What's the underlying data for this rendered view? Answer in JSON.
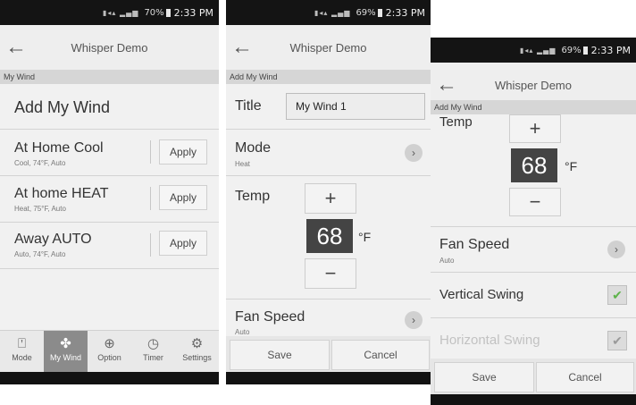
{
  "phone1": {
    "status": {
      "time": "2:33 PM",
      "battery": "70%"
    },
    "appbar": {
      "title": "Whisper Demo"
    },
    "section": "My Wind",
    "header": "Add My Wind",
    "items": [
      {
        "title": "At Home Cool",
        "subtitle": "Cool, 74°F, Auto",
        "action": "Apply"
      },
      {
        "title": "At home HEAT",
        "subtitle": "Heat, 75°F, Auto",
        "action": "Apply"
      },
      {
        "title": "Away AUTO",
        "subtitle": "Auto, 74°F, Auto",
        "action": "Apply"
      }
    ],
    "nav": [
      {
        "label": "Mode",
        "icon": "mode-icon"
      },
      {
        "label": "My Wind",
        "icon": "fan-icon"
      },
      {
        "label": "Option",
        "icon": "plus-circle-icon"
      },
      {
        "label": "Timer",
        "icon": "clock-icon"
      },
      {
        "label": "Settings",
        "icon": "gear-icon"
      }
    ]
  },
  "phone2": {
    "status": {
      "time": "2:33 PM",
      "battery": "69%"
    },
    "appbar": {
      "title": "Whisper Demo"
    },
    "section": "Add My Wind",
    "title_label": "Title",
    "title_value": "My Wind 1",
    "mode_label": "Mode",
    "mode_value": "Heat",
    "temp_label": "Temp",
    "temp_plus": "+",
    "temp_value": "68",
    "temp_unit": "°F",
    "temp_minus": "−",
    "fan_label": "Fan Speed",
    "fan_value": "Auto",
    "save": "Save",
    "cancel": "Cancel"
  },
  "phone3": {
    "status": {
      "time": "2:33 PM",
      "battery": "69%"
    },
    "appbar": {
      "title": "Whisper Demo"
    },
    "section": "Add My Wind",
    "temp_label": "Temp",
    "temp_plus": "+",
    "temp_value": "68",
    "temp_unit": "°F",
    "temp_minus": "−",
    "fan_label": "Fan Speed",
    "fan_value": "Auto",
    "vswing_label": "Vertical Swing",
    "hswing_label": "Horizontal Swing",
    "save": "Save",
    "cancel": "Cancel",
    "colors": {
      "check_green": "#5db34a",
      "temp_box": "#444444",
      "active_tab": "#8b8b8b"
    }
  }
}
